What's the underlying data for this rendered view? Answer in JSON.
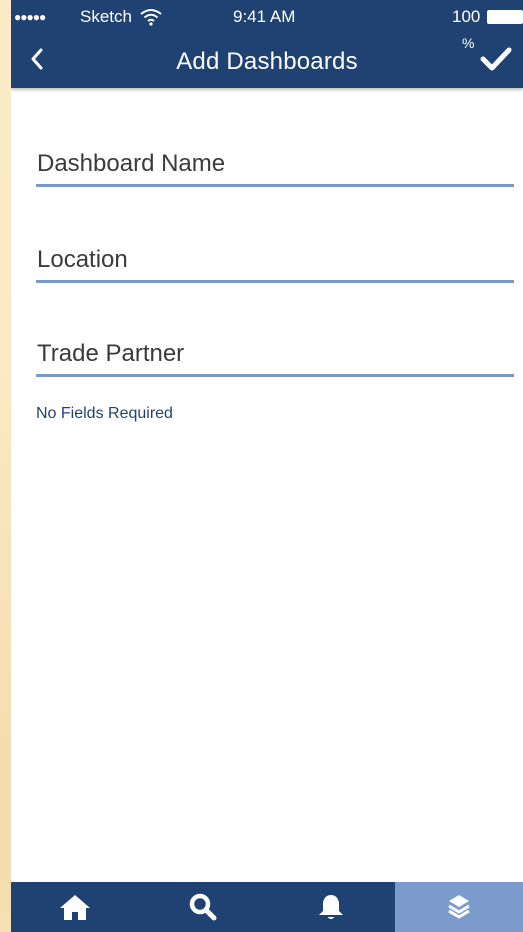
{
  "status_bar": {
    "signal": "●●●●●",
    "carrier": "Sketch",
    "time": "9:41 AM",
    "battery": "100",
    "battery_suffix": "%"
  },
  "header": {
    "title": "Add Dashboards",
    "back_icon": "chevron-left-icon",
    "confirm_icon": "checkmark-icon"
  },
  "form": {
    "fields": [
      {
        "label": "Dashboard Name",
        "value": ""
      },
      {
        "label": "Location",
        "value": ""
      },
      {
        "label": "Trade Partner",
        "value": ""
      }
    ],
    "required_note": "No Fields Required"
  },
  "tabbar": {
    "tabs": [
      {
        "icon": "home-icon",
        "active": false
      },
      {
        "icon": "search-icon",
        "active": false
      },
      {
        "icon": "bell-icon",
        "active": false
      },
      {
        "icon": "layers-icon",
        "active": true
      }
    ]
  },
  "colors": {
    "header_bg": "#1f4273",
    "field_underline": "#7a98c5",
    "active_tab_bg": "#7b9bcd",
    "background": "#f6e6be"
  }
}
